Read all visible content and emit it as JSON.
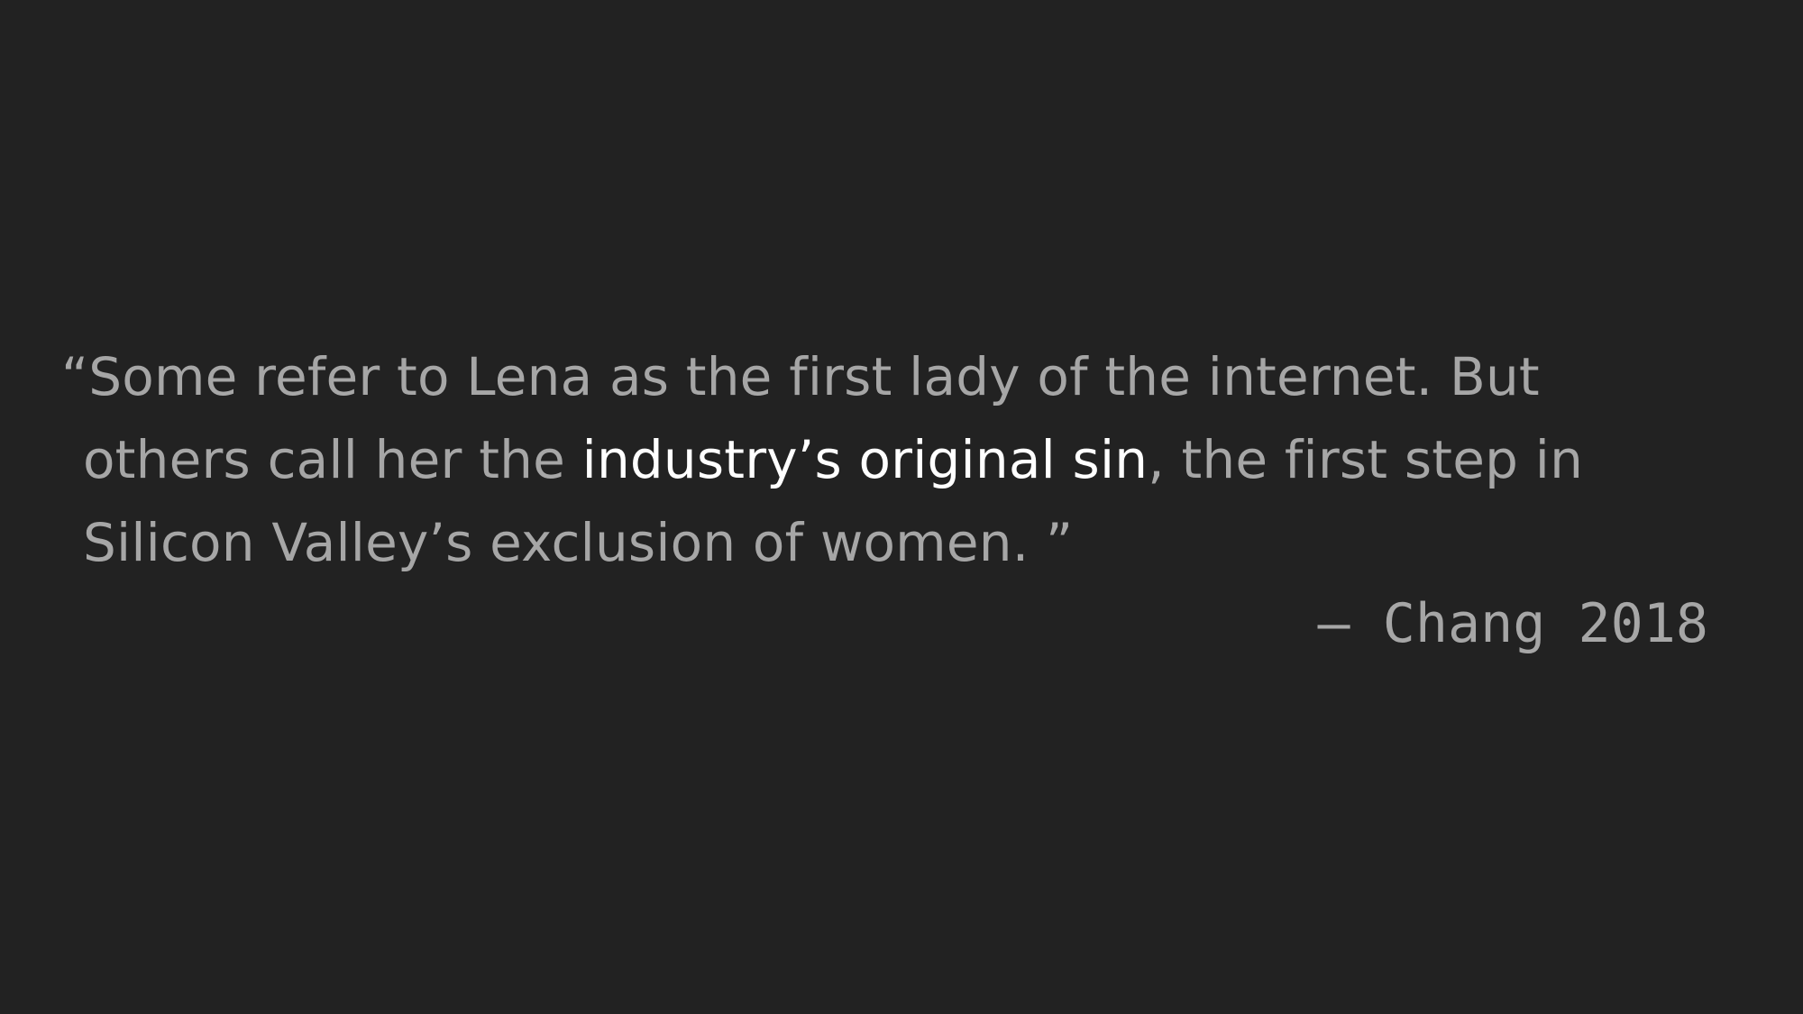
{
  "quote": {
    "line1": "“Some refer to Lena as the first lady of the internet. But",
    "line2_before": "others call her the ",
    "line2_highlight": "industry’s original sin",
    "line2_after": ", the first step in",
    "line3": "Silicon Valley’s exclusion of women. ”"
  },
  "attribution": "— Chang 2018",
  "colors": {
    "background": "#222222",
    "text": "#a6a6a6",
    "highlight": "#ffffff"
  }
}
